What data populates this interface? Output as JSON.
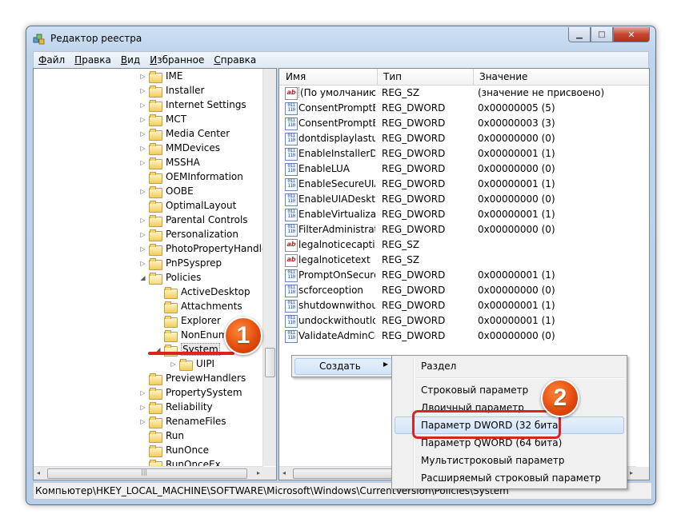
{
  "window": {
    "title": "Редактор реестра",
    "minimize_glyph": "▁",
    "maximize_glyph": "□",
    "close_glyph": "✕"
  },
  "menubar": [
    {
      "first": "Ф",
      "rest": "айл"
    },
    {
      "first": "П",
      "rest": "равка"
    },
    {
      "first": "В",
      "rest": "ид"
    },
    {
      "first": "И",
      "rest": "збранное"
    },
    {
      "first": "С",
      "rest": "правка"
    }
  ],
  "tree": {
    "items": [
      {
        "label": "IME",
        "expander": "▷",
        "indent": 0
      },
      {
        "label": "Installer",
        "expander": "▷",
        "indent": 0
      },
      {
        "label": "Internet Settings",
        "expander": "▷",
        "indent": 0
      },
      {
        "label": "MCT",
        "expander": "▷",
        "indent": 0
      },
      {
        "label": "Media Center",
        "expander": "▷",
        "indent": 0
      },
      {
        "label": "MMDevices",
        "expander": "▷",
        "indent": 0
      },
      {
        "label": "MSSHA",
        "expander": "▷",
        "indent": 0
      },
      {
        "label": "OEMInformation",
        "expander": "",
        "indent": 0
      },
      {
        "label": "OOBE",
        "expander": "▷",
        "indent": 0
      },
      {
        "label": "OptimalLayout",
        "expander": "",
        "indent": 0
      },
      {
        "label": "Parental Controls",
        "expander": "▷",
        "indent": 0
      },
      {
        "label": "Personalization",
        "expander": "▷",
        "indent": 0
      },
      {
        "label": "PhotoPropertyHandler",
        "expander": "▷",
        "indent": 0
      },
      {
        "label": "PnPSysprep",
        "expander": "▷",
        "indent": 0
      },
      {
        "label": "Policies",
        "expander": "◢",
        "indent": 0
      },
      {
        "label": "ActiveDesktop",
        "expander": "",
        "indent": 1
      },
      {
        "label": "Attachments",
        "expander": "",
        "indent": 1
      },
      {
        "label": "Explorer",
        "expander": "",
        "indent": 1
      },
      {
        "label": "NonEnum",
        "expander": "",
        "indent": 1
      },
      {
        "label": "System",
        "expander": "◢",
        "indent": 1
      },
      {
        "label": "UIPI",
        "expander": "▷",
        "indent": 2
      },
      {
        "label": "PreviewHandlers",
        "expander": "",
        "indent": 0
      },
      {
        "label": "PropertySystem",
        "expander": "▷",
        "indent": 0
      },
      {
        "label": "Reliability",
        "expander": "▷",
        "indent": 0
      },
      {
        "label": "RenameFiles",
        "expander": "▷",
        "indent": 0
      },
      {
        "label": "Run",
        "expander": "",
        "indent": 0
      },
      {
        "label": "RunOnce",
        "expander": "",
        "indent": 0
      },
      {
        "label": "RunOnceEx",
        "expander": "",
        "indent": 0
      }
    ],
    "selected_index": 19,
    "scroll_left": "◂",
    "scroll_right": "▸",
    "scroll_grip": "|||"
  },
  "list": {
    "headers": {
      "name": "Имя",
      "type": "Тип",
      "value": "Значение"
    },
    "rows": [
      {
        "name": "(По умолчанию)",
        "type": "REG_SZ",
        "value": "(значение не присвоено)",
        "icon": "sz"
      },
      {
        "name": "ConsentPromptBehaviorAdmin",
        "type": "REG_DWORD",
        "value": "0x00000005 (5)",
        "icon": "bin"
      },
      {
        "name": "ConsentPromptBehaviorUser",
        "type": "REG_DWORD",
        "value": "0x00000003 (3)",
        "icon": "bin"
      },
      {
        "name": "dontdisplaylastusername",
        "type": "REG_DWORD",
        "value": "0x00000000 (0)",
        "icon": "bin"
      },
      {
        "name": "EnableInstallerDetection",
        "type": "REG_DWORD",
        "value": "0x00000001 (1)",
        "icon": "bin"
      },
      {
        "name": "EnableLUA",
        "type": "REG_DWORD",
        "value": "0x00000000 (0)",
        "icon": "bin"
      },
      {
        "name": "EnableSecureUIAPaths",
        "type": "REG_DWORD",
        "value": "0x00000001 (1)",
        "icon": "bin"
      },
      {
        "name": "EnableUIADesktopToggle",
        "type": "REG_DWORD",
        "value": "0x00000000 (0)",
        "icon": "bin"
      },
      {
        "name": "EnableVirtualization",
        "type": "REG_DWORD",
        "value": "0x00000001 (1)",
        "icon": "bin"
      },
      {
        "name": "FilterAdministratorToken",
        "type": "REG_DWORD",
        "value": "0x00000000 (0)",
        "icon": "bin"
      },
      {
        "name": "legalnoticecaption",
        "type": "REG_SZ",
        "value": "",
        "icon": "sz"
      },
      {
        "name": "legalnoticetext",
        "type": "REG_SZ",
        "value": "",
        "icon": "sz"
      },
      {
        "name": "PromptOnSecureDesktop",
        "type": "REG_DWORD",
        "value": "0x00000001 (1)",
        "icon": "bin"
      },
      {
        "name": "scforceoption",
        "type": "REG_DWORD",
        "value": "0x00000000 (0)",
        "icon": "bin"
      },
      {
        "name": "shutdownwithoutlogon",
        "type": "REG_DWORD",
        "value": "0x00000001 (1)",
        "icon": "bin"
      },
      {
        "name": "undockwithoutlogon",
        "type": "REG_DWORD",
        "value": "0x00000001 (1)",
        "icon": "bin"
      },
      {
        "name": "ValidateAdminCodeSignatures",
        "type": "REG_DWORD",
        "value": "0x00000000 (0)",
        "icon": "bin"
      }
    ],
    "sz_glyph": "ab",
    "bin_glyph": "011 110"
  },
  "context_menu": {
    "create_label": "Создать",
    "create_arrow": "▶",
    "submenu": [
      "Раздел",
      "Строковый параметр",
      "Двоичный параметр",
      "Параметр DWORD (32 бита)",
      "Параметр QWORD (64 бита)",
      "Мультистроковый параметр",
      "Расширяемый строковый параметр"
    ],
    "highlighted_index": 3
  },
  "callouts": {
    "step1": "1",
    "step2": "2"
  },
  "status": "Компьютер\\HKEY_LOCAL_MACHINE\\SOFTWARE\\Microsoft\\Windows\\CurrentVersion\\Policies\\System",
  "colors": {
    "callout_orange": "#e2470b",
    "highlight_red": "#d9251d"
  }
}
